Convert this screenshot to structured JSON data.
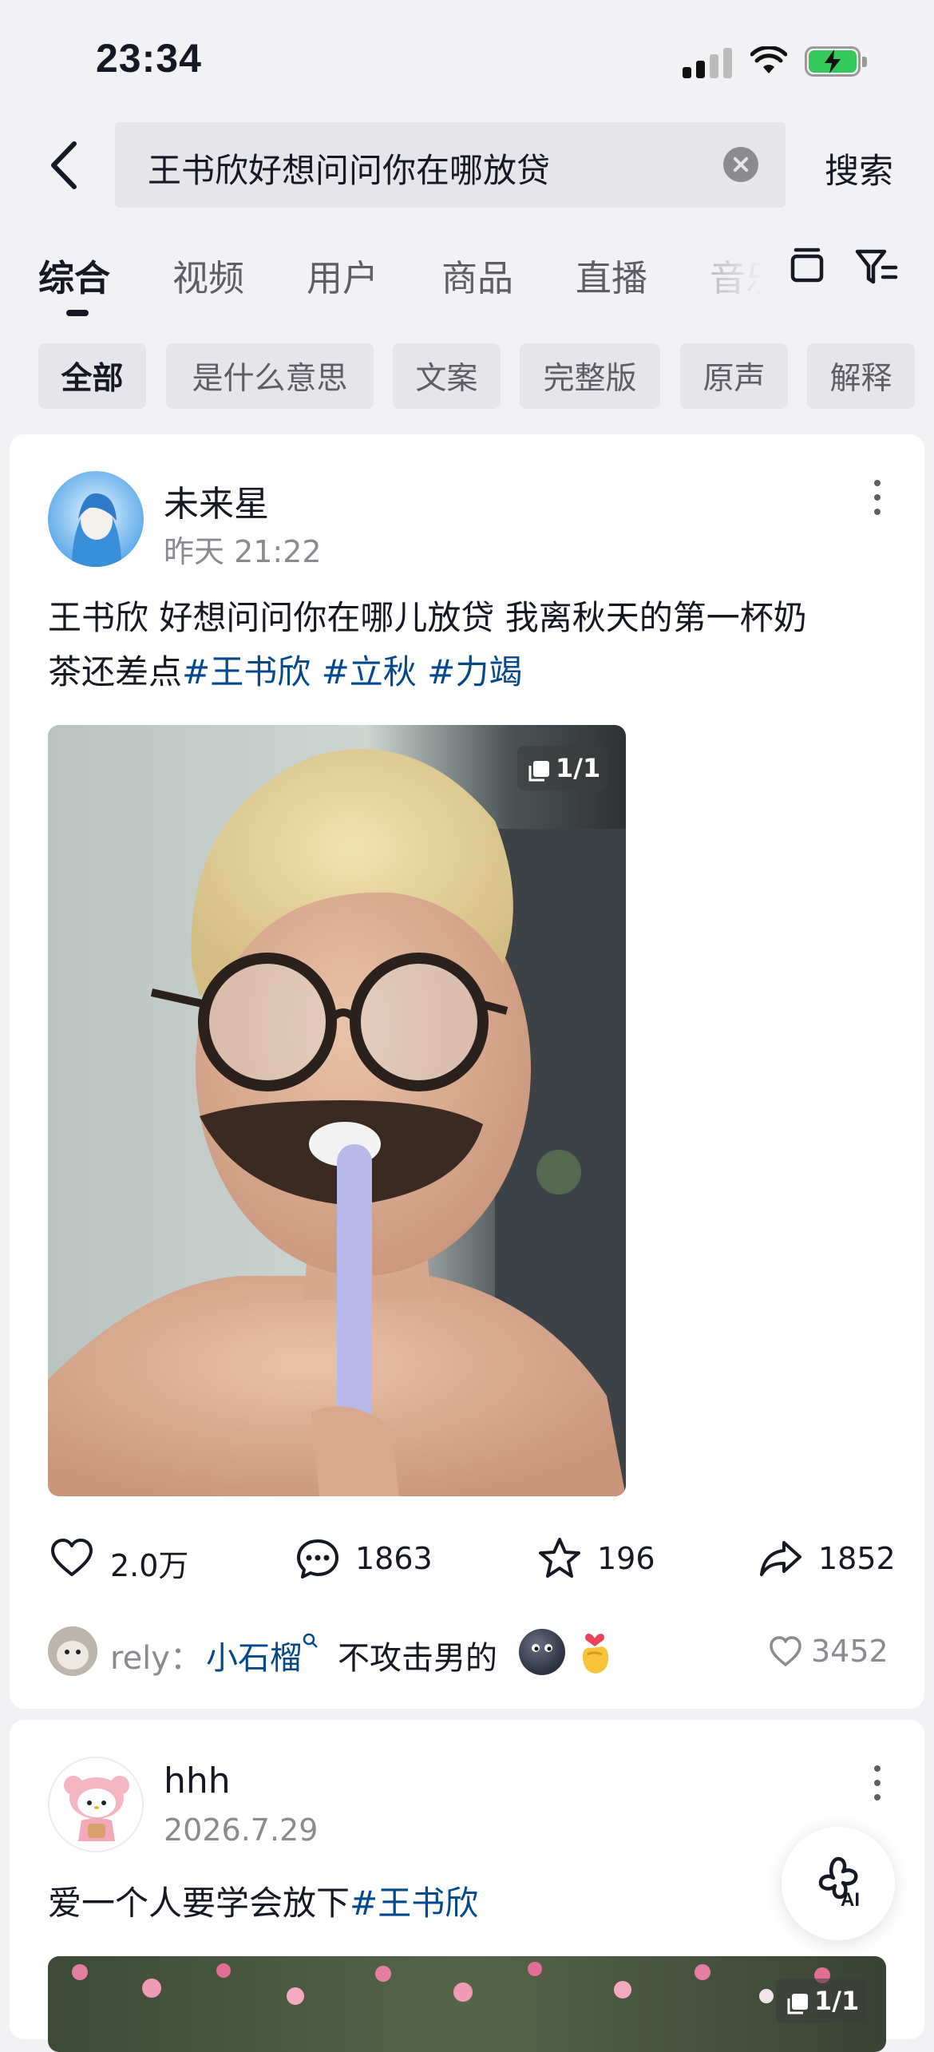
{
  "status_bar": {
    "time": "23:34"
  },
  "search": {
    "query": "王书欣好想问问你在哪放贷",
    "button_label": "搜索"
  },
  "tabs": [
    {
      "label": "综合",
      "active": true
    },
    {
      "label": "视频"
    },
    {
      "label": "用户"
    },
    {
      "label": "商品"
    },
    {
      "label": "直播"
    },
    {
      "label": "音乐"
    }
  ],
  "chips": [
    {
      "label": "全部",
      "active": true
    },
    {
      "label": "是什么意思"
    },
    {
      "label": "文案"
    },
    {
      "label": "完整版"
    },
    {
      "label": "原声"
    },
    {
      "label": "解释"
    }
  ],
  "post1": {
    "username": "未来星",
    "time": "昨天 21:22",
    "text_line1": "王书欣 好想问问你在哪儿放贷 我离秋天的第一杯奶",
    "text_line2_plain": "茶还差点",
    "hashtags": [
      "#王书欣",
      "#立秋",
      "#力竭"
    ],
    "image_count": "1/1",
    "likes": "2.0万",
    "comments": "1863",
    "favorites": "196",
    "shares": "1852",
    "top_comment": {
      "user": "rely：",
      "mention": "小石榴",
      "text": "不攻击男的",
      "likes": "3452"
    }
  },
  "post2": {
    "username": "hhh",
    "time": "2026.7.29",
    "text_plain": "爱一个人要学会放下",
    "hashtag": "#王书欣",
    "image_count": "1/1"
  },
  "ai_button": {
    "label": "AI"
  }
}
